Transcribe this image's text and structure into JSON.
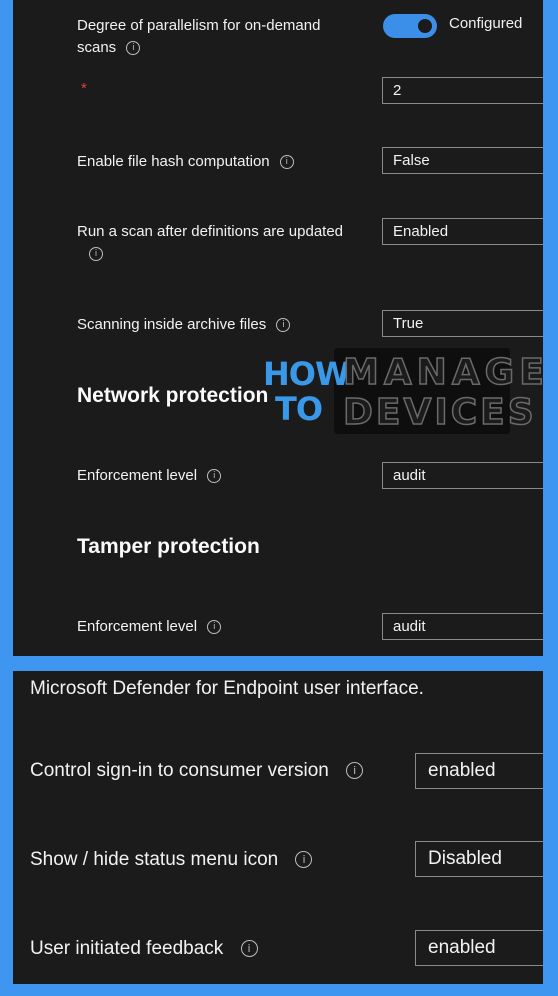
{
  "top": {
    "parallelism": {
      "label_line1": "Degree of parallelism for on-demand",
      "label_line2": "scans",
      "toggle_label": "Configured",
      "value": "2",
      "required_mark": "*"
    },
    "file_hash": {
      "label": "Enable file hash computation",
      "value": "False"
    },
    "scan_after_update": {
      "label": "Run a scan after definitions are updated",
      "value": "Enabled"
    },
    "archive_scan": {
      "label": "Scanning inside archive files",
      "value": "True"
    },
    "network_protection": {
      "title": "Network protection",
      "enforcement_label": "Enforcement level",
      "enforcement_value": "audit"
    },
    "tamper_protection": {
      "title": "Tamper protection",
      "enforcement_label": "Enforcement level",
      "enforcement_value": "audit"
    }
  },
  "watermark": {
    "how": "HOW",
    "to": "TO",
    "manage": "MANAGE",
    "devices": "DEVICES"
  },
  "bottom": {
    "intro_text": "Microsoft Defender for Endpoint user interface.",
    "consumer_signin": {
      "label": "Control sign-in to consumer version",
      "value": "enabled"
    },
    "status_menu_icon": {
      "label": "Show / hide status menu icon",
      "value": "Disabled"
    },
    "user_feedback": {
      "label": "User initiated feedback",
      "value": "enabled"
    }
  },
  "icons": {
    "info": "info-icon",
    "info_glyph": "i"
  }
}
